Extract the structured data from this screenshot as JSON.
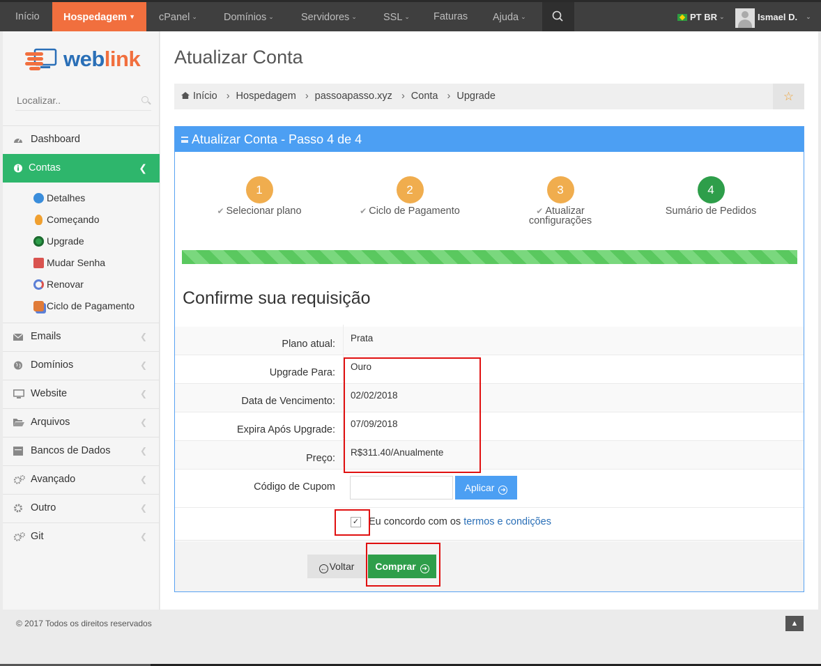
{
  "nav": {
    "items": [
      {
        "label": "Início",
        "caret": false
      },
      {
        "label": "Hospedagem",
        "caret": true,
        "active": true
      },
      {
        "label": "cPanel",
        "caret": true
      },
      {
        "label": "Domínios",
        "caret": true
      },
      {
        "label": "Servidores",
        "caret": true
      },
      {
        "label": "SSL",
        "caret": true
      },
      {
        "label": "Faturas",
        "caret": false
      },
      {
        "label": "Ajuda",
        "caret": true
      }
    ],
    "language": "PT BR",
    "user": "Ismael D."
  },
  "sidebar": {
    "logo_text_a": "web",
    "logo_text_b": "link",
    "search_placeholder": "Localizar..",
    "items": [
      {
        "label": "Dashboard"
      },
      {
        "label": "Contas"
      },
      {
        "label": "Emails"
      },
      {
        "label": "Domínios"
      },
      {
        "label": "Website"
      },
      {
        "label": "Arquivos"
      },
      {
        "label": "Bancos de Dados"
      },
      {
        "label": "Avançado"
      },
      {
        "label": "Outro"
      },
      {
        "label": "Git"
      }
    ],
    "sub_items": [
      {
        "label": "Detalhes",
        "color": "#3a8ddb"
      },
      {
        "label": "Começando",
        "color": "#f0a030"
      },
      {
        "label": "Upgrade",
        "color": "#2e9e4a"
      },
      {
        "label": "Mudar Senha",
        "color": "#d9534f"
      },
      {
        "label": "Renovar",
        "color": "#5b7fd6"
      },
      {
        "label": "Ciclo de Pagamento",
        "color": "#e07b39"
      }
    ]
  },
  "page": {
    "title": "Atualizar Conta",
    "breadcrumb": [
      "Início",
      "Hospedagem",
      "passoapasso.xyz",
      "Conta",
      "Upgrade"
    ]
  },
  "panel": {
    "title": "Atualizar Conta - Passo 4 de 4",
    "steps": [
      {
        "num": "1",
        "label": "Selecionar plano"
      },
      {
        "num": "2",
        "label": "Ciclo de Pagamento"
      },
      {
        "num": "3",
        "label": "Atualizar configurações"
      },
      {
        "num": "4",
        "label": "Sumário de Pedidos"
      }
    ],
    "progress": 1.0,
    "confirm_title": "Confirme sua requisição",
    "rows": [
      {
        "label": "Plano atual:",
        "value": "Prata"
      },
      {
        "label": "Upgrade Para:",
        "value": "Ouro"
      },
      {
        "label": "Data de Vencimento:",
        "value": "02/02/2018"
      },
      {
        "label": "Expira Após Upgrade:",
        "value": "07/09/2018"
      },
      {
        "label": "Preço:",
        "value": "R$311.40/Anualmente"
      }
    ],
    "coupon_label": "Código de Cupom",
    "coupon_value": "",
    "apply_label": "Aplicar",
    "agree_text": "Eu concordo com os ",
    "agree_link": "termos e condições",
    "agree_checked": true,
    "back_label": "Voltar",
    "buy_label": "Comprar"
  },
  "footer": {
    "copyright": "© 2017 Todos os direitos reservados"
  },
  "colors": {
    "accent_orange": "#f16f3e",
    "active_green": "#2eb66c",
    "panel_blue": "#4c9ff3",
    "step_pending": "#f0ad4e",
    "step_done": "#2e9e4a",
    "highlight_red": "#e01010"
  }
}
